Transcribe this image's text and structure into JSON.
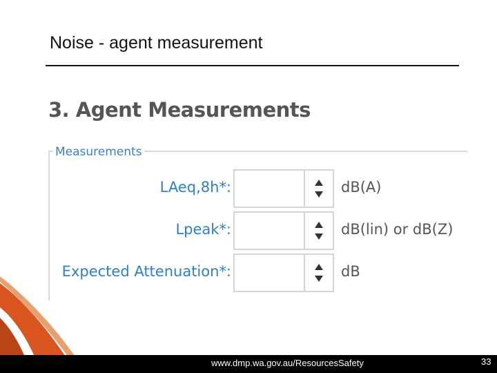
{
  "slide": {
    "title": "Noise - agent measurement"
  },
  "form": {
    "section_heading": "3. Agent Measurements",
    "legend": "Measurements",
    "fields": [
      {
        "label": "LAeq,8h*:",
        "value": "",
        "unit": "dB(A)"
      },
      {
        "label": "Lpeak*:",
        "value": "",
        "unit": "dB(lin) or dB(Z)"
      },
      {
        "label": "Expected Attenuation*:",
        "value": "",
        "unit": "dB"
      }
    ]
  },
  "footer": {
    "url": "www.dmp.wa.gov.au/ResourcesSafety",
    "page_number": "33"
  },
  "colors": {
    "label_blue": "#2f7fc8",
    "swoosh_orange": "#d9551f",
    "footer_bg": "#000000"
  }
}
